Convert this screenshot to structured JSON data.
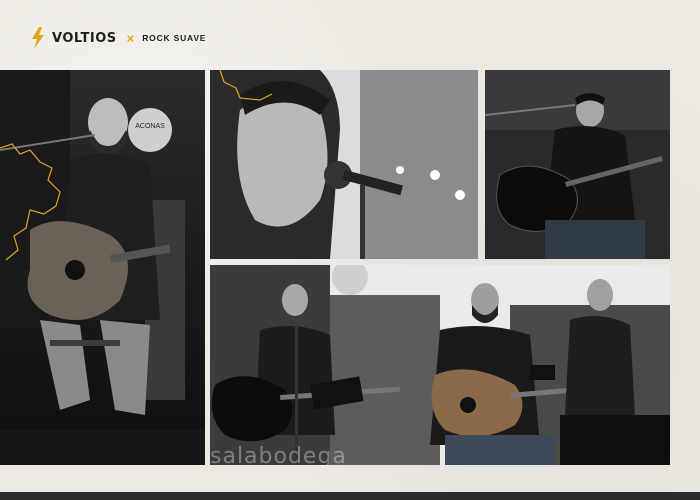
{
  "header": {
    "brand": "VOLTIOS",
    "separator": "×",
    "partner": "ROCK SUAVE"
  },
  "photos": {
    "a": {
      "sign_text": "ACONAS"
    },
    "d": {}
  },
  "watermark": "salabodega",
  "colors": {
    "accent": "#e2a51a",
    "paper": "#ece9e2",
    "ink": "#1e1e1e"
  },
  "icons": {
    "brand_logo": "lightning-bolt-icon"
  }
}
